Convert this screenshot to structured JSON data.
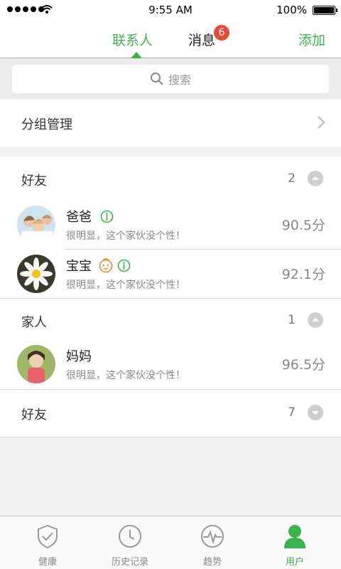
{
  "status_bar": {
    "time": "9:55 AM",
    "battery": "100%"
  },
  "nav": {
    "tab_contacts": "联系人",
    "tab_messages": "消息",
    "messages_badge": "6",
    "add": "添加"
  },
  "search": {
    "placeholder": "搜索"
  },
  "group_management": {
    "label": "分组管理"
  },
  "groups": [
    {
      "title": "好友",
      "count": "2",
      "expanded": true,
      "contacts": [
        {
          "name": "爸爸",
          "signature": "很明显，这个家伙没个性！",
          "score": "90.5分"
        },
        {
          "name": "宝宝",
          "signature": "很明显，这个家伙没个性！",
          "score": "92.1分"
        }
      ]
    },
    {
      "title": "家人",
      "count": "1",
      "expanded": true,
      "contacts": [
        {
          "name": "妈妈",
          "signature": "很明显，这个家伙没个性！",
          "score": "96.5分"
        }
      ]
    },
    {
      "title": "好友",
      "count": "7",
      "expanded": false,
      "contacts": []
    }
  ],
  "tab_bar": {
    "items": [
      {
        "label": "健康",
        "icon": "shield-check-icon"
      },
      {
        "label": "历史记录",
        "icon": "clock-icon"
      },
      {
        "label": "趋势",
        "icon": "pulse-icon"
      },
      {
        "label": "用户",
        "icon": "user-icon",
        "active": true
      }
    ]
  },
  "colors": {
    "accent": "#3cb34a",
    "badge": "#e84a3a",
    "baby_icon": "#f08a1c"
  }
}
